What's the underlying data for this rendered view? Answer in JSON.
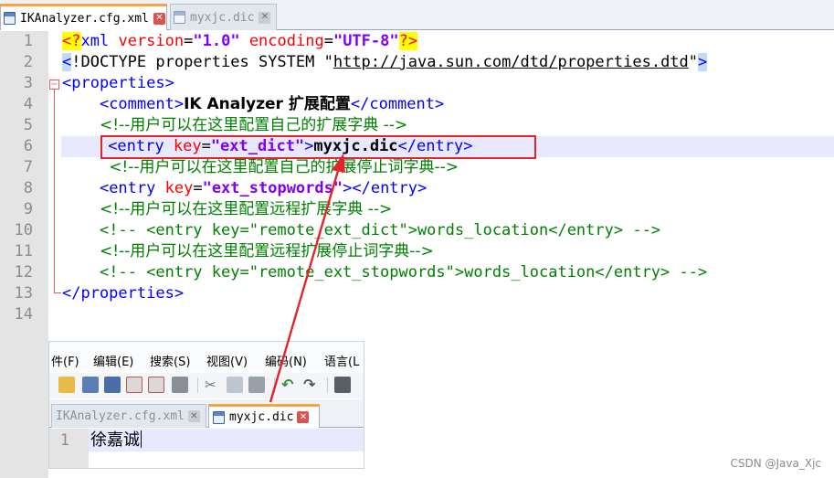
{
  "editor": {
    "tabs": [
      {
        "label": "IKAnalyzer.cfg.xml",
        "active": true
      },
      {
        "label": "myxjc.dic",
        "active": false
      }
    ],
    "line_numbers": [
      "1",
      "2",
      "3",
      "4",
      "5",
      "6",
      "7",
      "8",
      "9",
      "10",
      "11",
      "12",
      "13",
      "14"
    ],
    "current_line": 6,
    "lines": {
      "l1": {
        "lt": "<",
        "q": "?",
        "name": "xml",
        "a1": "version",
        "eq1": "=",
        "v1": "\"1.0\"",
        "a2": "encoding",
        "eq2": "=",
        "v2": "\"UTF-8\"",
        "end": "?>"
      },
      "l2": {
        "lt": "<",
        "bang": "!",
        "text": "DOCTYPE properties SYSTEM \"",
        "url": "http://java.sun.com/dtd/properties.dtd",
        "close": "\"",
        "gt": ">"
      },
      "l3": {
        "open": "<properties>"
      },
      "l4": {
        "open": "<comment>",
        "text": "IK Analyzer 扩展配置",
        "close": "</comment>"
      },
      "l5": {
        "comment": "<!--用户可以在这里配置自己的扩展字典 -->"
      },
      "l6": {
        "open": "<entry",
        "attr": " key",
        "eq": "=",
        "val": "\"ext_dict\"",
        "gt": ">",
        "text": "myxjc.dic",
        "close": "</entry>"
      },
      "l7": {
        "comment": "<!--用户可以在这里配置自己的扩展停止词字典-->"
      },
      "l8": {
        "open": "<entry",
        "attr": " key",
        "eq": "=",
        "val": "\"ext_stopwords\"",
        "gt": ">",
        "close": "</entry>"
      },
      "l9": {
        "comment": "<!--用户可以在这里配置远程扩展字典 -->"
      },
      "l10": {
        "comment": "<!-- <entry key=\"remote_ext_dict\">words_location</entry> -->"
      },
      "l11": {
        "comment": "<!--用户可以在这里配置远程扩展停止词字典-->"
      },
      "l12": {
        "comment": "<!-- <entry key=\"remote_ext_stopwords\">words_location</entry> -->"
      },
      "l13": {
        "close": "</properties>"
      }
    }
  },
  "overlay": {
    "menu": [
      "件(F)",
      "编辑(E)",
      "搜索(S)",
      "视图(V)",
      "编码(N)",
      "语言(L"
    ],
    "toolbar_icons": [
      "open-icon",
      "save-icon",
      "save-all-icon",
      "close-file-icon",
      "close-all-icon",
      "print-icon",
      "cut-icon",
      "copy-icon",
      "paste-icon",
      "undo-icon",
      "redo-icon",
      "find-icon"
    ],
    "tabs": [
      {
        "label": "IKAnalyzer.cfg.xml",
        "active": false
      },
      {
        "label": "myxjc.dic",
        "active": true
      }
    ],
    "line_number": "1",
    "content": "徐嘉诚"
  },
  "colors": {
    "highlight_box": "#e0252d",
    "arrow": "#e0252d",
    "tag": "#0000ff",
    "attribute": "#ff0000",
    "string": "#8000ff",
    "comment": "#008000",
    "current_line": "#e8e8ff",
    "active_tab_accent": "#f5a53c"
  },
  "watermark": "CSDN @Java_Xjc"
}
